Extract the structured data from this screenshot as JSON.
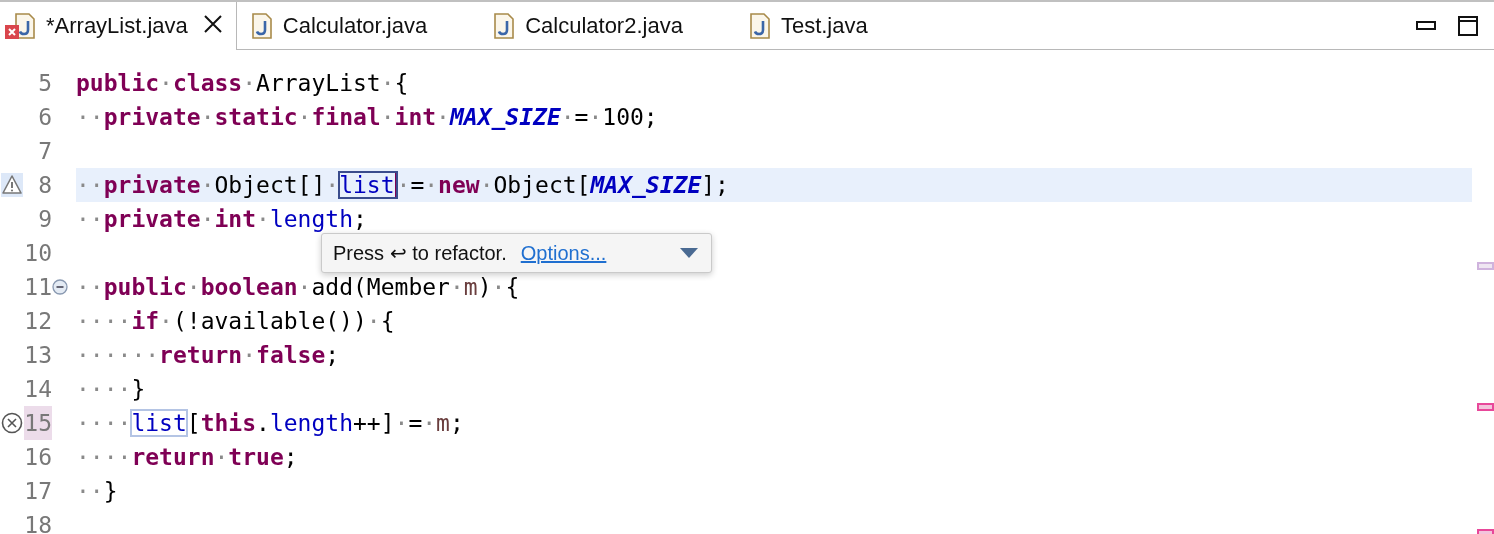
{
  "tabs": [
    {
      "label": "*ArrayList.java",
      "selected": true,
      "error": true
    },
    {
      "label": "Calculator.java",
      "selected": false,
      "error": false
    },
    {
      "label": "Calculator2.java",
      "selected": false,
      "error": false
    },
    {
      "label": "Test.java",
      "selected": false,
      "error": false
    }
  ],
  "editor": {
    "lines": [
      {
        "number": "5",
        "tokens": [
          {
            "text": "public",
            "kind": "keyword"
          },
          {
            "text": "·",
            "kind": "ws"
          },
          {
            "text": "class",
            "kind": "keyword"
          },
          {
            "text": "·",
            "kind": "ws"
          },
          {
            "text": "ArrayList",
            "kind": "plain"
          },
          {
            "text": "·",
            "kind": "ws"
          },
          {
            "text": "{",
            "kind": "plain"
          }
        ]
      },
      {
        "number": "6",
        "tokens": [
          {
            "text": "··",
            "kind": "ws"
          },
          {
            "text": "private",
            "kind": "keyword"
          },
          {
            "text": "·",
            "kind": "ws"
          },
          {
            "text": "static",
            "kind": "keyword"
          },
          {
            "text": "·",
            "kind": "ws"
          },
          {
            "text": "final",
            "kind": "keyword"
          },
          {
            "text": "·",
            "kind": "ws"
          },
          {
            "text": "int",
            "kind": "keyword"
          },
          {
            "text": "·",
            "kind": "ws"
          },
          {
            "text": "MAX_SIZE",
            "kind": "constant"
          },
          {
            "text": "·",
            "kind": "ws"
          },
          {
            "text": "=",
            "kind": "plain"
          },
          {
            "text": "·",
            "kind": "ws"
          },
          {
            "text": "100;",
            "kind": "plain"
          }
        ]
      },
      {
        "number": "7"
      },
      {
        "number": "8",
        "current": true,
        "warning": true,
        "tokens": [
          {
            "text": "··",
            "kind": "ws"
          },
          {
            "text": "private",
            "kind": "keyword"
          },
          {
            "text": "·",
            "kind": "ws"
          },
          {
            "text": "Object[]",
            "kind": "plain"
          },
          {
            "text": "·",
            "kind": "ws"
          },
          {
            "text": "list",
            "kind": "field",
            "occurrence": true,
            "caret": true
          },
          {
            "text": "·",
            "kind": "ws"
          },
          {
            "text": "=",
            "kind": "plain"
          },
          {
            "text": "·",
            "kind": "ws"
          },
          {
            "text": "new",
            "kind": "keyword"
          },
          {
            "text": "·",
            "kind": "ws"
          },
          {
            "text": "Object[",
            "kind": "plain"
          },
          {
            "text": "MAX_SIZE",
            "kind": "constant"
          },
          {
            "text": "];",
            "kind": "plain"
          }
        ]
      },
      {
        "number": "9",
        "tokens": [
          {
            "text": "··",
            "kind": "ws"
          },
          {
            "text": "private",
            "kind": "keyword"
          },
          {
            "text": "·",
            "kind": "ws"
          },
          {
            "text": "int",
            "kind": "keyword"
          },
          {
            "text": "·",
            "kind": "ws"
          },
          {
            "text": "length",
            "kind": "field"
          },
          {
            "text": ";",
            "kind": "plain"
          }
        ]
      },
      {
        "number": "10"
      },
      {
        "number": "11",
        "expanded": true,
        "tokens": [
          {
            "text": "··",
            "kind": "ws"
          },
          {
            "text": "public",
            "kind": "keyword"
          },
          {
            "text": "·",
            "kind": "ws"
          },
          {
            "text": "boolean",
            "kind": "keyword"
          },
          {
            "text": "·",
            "kind": "ws"
          },
          {
            "text": "add(Member",
            "kind": "plain"
          },
          {
            "text": "·",
            "kind": "ws"
          },
          {
            "text": "m",
            "kind": "param"
          },
          {
            "text": ")",
            "kind": "plain"
          },
          {
            "text": "·",
            "kind": "ws"
          },
          {
            "text": "{",
            "kind": "plain"
          }
        ]
      },
      {
        "number": "12",
        "tokens": [
          {
            "text": "····",
            "kind": "ws"
          },
          {
            "text": "if",
            "kind": "keyword"
          },
          {
            "text": "·",
            "kind": "ws"
          },
          {
            "text": "(!available())",
            "kind": "plain"
          },
          {
            "text": "·",
            "kind": "ws"
          },
          {
            "text": "{",
            "kind": "plain"
          }
        ]
      },
      {
        "number": "13",
        "tokens": [
          {
            "text": "······",
            "kind": "ws"
          },
          {
            "text": "return",
            "kind": "keyword"
          },
          {
            "text": "·",
            "kind": "ws"
          },
          {
            "text": "false",
            "kind": "keyword"
          },
          {
            "text": ";",
            "kind": "plain"
          }
        ]
      },
      {
        "number": "14",
        "tokens": [
          {
            "text": "····",
            "kind": "ws"
          },
          {
            "text": "}",
            "kind": "plain"
          }
        ]
      },
      {
        "number": "15",
        "error": true,
        "tokens": [
          {
            "text": "····",
            "kind": "ws"
          },
          {
            "text": "list",
            "kind": "field",
            "occurrence": true
          },
          {
            "text": "[",
            "kind": "plain"
          },
          {
            "text": "this",
            "kind": "keyword"
          },
          {
            "text": ".",
            "kind": "plain"
          },
          {
            "text": "length",
            "kind": "field"
          },
          {
            "text": "++]",
            "kind": "plain"
          },
          {
            "text": "·",
            "kind": "ws"
          },
          {
            "text": "=",
            "kind": "plain"
          },
          {
            "text": "·",
            "kind": "ws"
          },
          {
            "text": "m",
            "kind": "param"
          },
          {
            "text": ";",
            "kind": "plain"
          }
        ]
      },
      {
        "number": "16",
        "tokens": [
          {
            "text": "····",
            "kind": "ws"
          },
          {
            "text": "return",
            "kind": "keyword"
          },
          {
            "text": "·",
            "kind": "ws"
          },
          {
            "text": "true",
            "kind": "keyword"
          },
          {
            "text": ";",
            "kind": "plain"
          }
        ]
      },
      {
        "number": "17",
        "tokens": [
          {
            "text": "··",
            "kind": "ws"
          },
          {
            "text": "}",
            "kind": "plain"
          }
        ]
      },
      {
        "number": "18"
      }
    ],
    "overview_marks": [
      {
        "kind": "occurrence"
      },
      {
        "kind": "error"
      },
      {
        "kind": "error"
      }
    ]
  },
  "popup": {
    "message": "Press ↩ to refactor.",
    "link": "Options..."
  }
}
